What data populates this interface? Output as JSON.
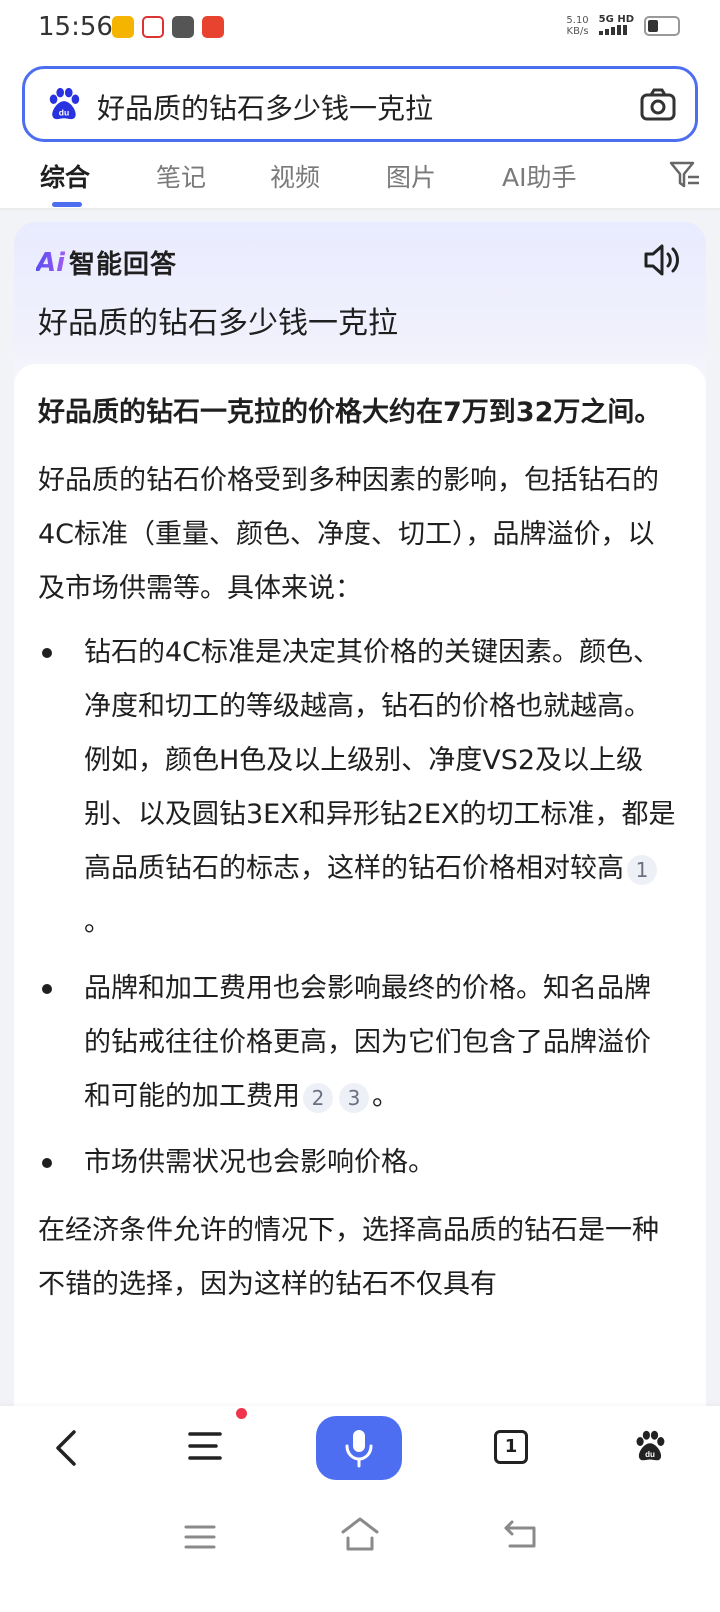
{
  "status_bar": {
    "time": "15:56",
    "net_speed": "5.10",
    "net_speed_unit": "KB/s",
    "network": "5G HD"
  },
  "search": {
    "query": "好品质的钻石多少钱一克拉"
  },
  "tabs": [
    {
      "label": "综合",
      "active": true
    },
    {
      "label": "笔记",
      "active": false
    },
    {
      "label": "视频",
      "active": false
    },
    {
      "label": "图片",
      "active": false
    },
    {
      "label": "AI助手",
      "active": false
    }
  ],
  "ai_answer": {
    "badge": "Ai",
    "label": "智能回答",
    "query": "好品质的钻石多少钱一克拉",
    "summary": "好品质的钻石一克拉的价格大约在7万到32万之间。",
    "intro": "好品质的钻石价格受到多种因素的影响，包括钻石的4C标准（重量、颜色、净度、切工），品牌溢价，以及市场供需等。具体来说：",
    "bullets": [
      {
        "text": "钻石的4C标准是决定其价格的关键因素。颜色、净度和切工的等级越高，钻石的价格也就越高。例如，颜色H色及以上级别、净度VS2及以上级别、以及圆钻3EX和异形钻2EX的切工标准，都是高品质钻石的标志，这样的钻石价格相对较高",
        "cites": [
          "1"
        ],
        "end": "。"
      },
      {
        "text": "品牌和加工费用也会影响最终的价格。知名品牌的钻戒往往价格更高，因为它们包含了品牌溢价和可能的加工费用",
        "cites": [
          "2",
          "3"
        ],
        "end": "。"
      },
      {
        "text": "市场供需状况也会影响价格。",
        "cites": [],
        "end": ""
      }
    ],
    "conclusion": "在经济条件允许的情况下，选择高品质的钻石是一种不错的选择，因为这样的钻石不仅具有"
  },
  "bottom_nav": {
    "tabs_count": "1"
  },
  "colors": {
    "accent": "#4e6ef2",
    "badge_dot": "#f0344e"
  }
}
